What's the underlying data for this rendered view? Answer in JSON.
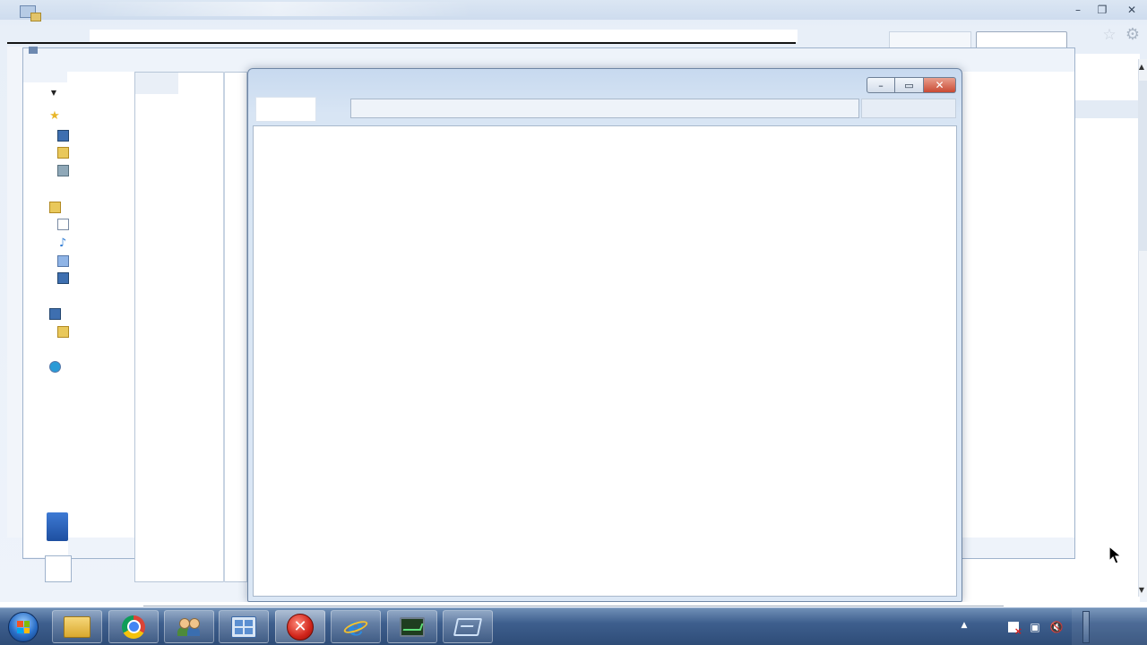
{
  "desktop": {
    "browser_window": {
      "caption_buttons": {
        "minimize": "–",
        "restore": "❐",
        "close": "✕"
      },
      "favorites_icon": "star-icon",
      "tools_icon": "gear-icon"
    },
    "explorer_window": {
      "nav_icons": [
        "star-icon",
        "desktop-icon",
        "folder-icon",
        "network-icon",
        "libraries-icon",
        "documents-icon",
        "music-icon",
        "pictures-icon",
        "videos-icon",
        "computer-icon",
        "drive-icon",
        "network-globe-icon"
      ]
    },
    "active_dialog": {
      "caption_buttons": {
        "minimize": "–",
        "maximize": "▭",
        "close": "✕"
      }
    }
  },
  "taskbar": {
    "start_button": "windows-orb",
    "pinned": [
      {
        "name": "windows-explorer",
        "icon": "folder-icon",
        "active": false
      },
      {
        "name": "google-chrome",
        "icon": "chrome-icon",
        "active": false
      },
      {
        "name": "user-accounts",
        "icon": "users-icon",
        "active": false
      },
      {
        "name": "control-panel",
        "icon": "control-panel-icon",
        "active": false
      },
      {
        "name": "error-app",
        "icon": "error-icon",
        "active": true
      },
      {
        "name": "internet-explorer",
        "icon": "ie-icon",
        "active": false
      },
      {
        "name": "task-manager",
        "icon": "monitor-icon",
        "active": false
      },
      {
        "name": "remote-desktop",
        "icon": "rdp-icon",
        "active": false
      }
    ],
    "tray": {
      "chevron": "▲",
      "icons": [
        "action-center-flag-icon",
        "network-icon",
        "volume-muted-icon"
      ]
    }
  }
}
